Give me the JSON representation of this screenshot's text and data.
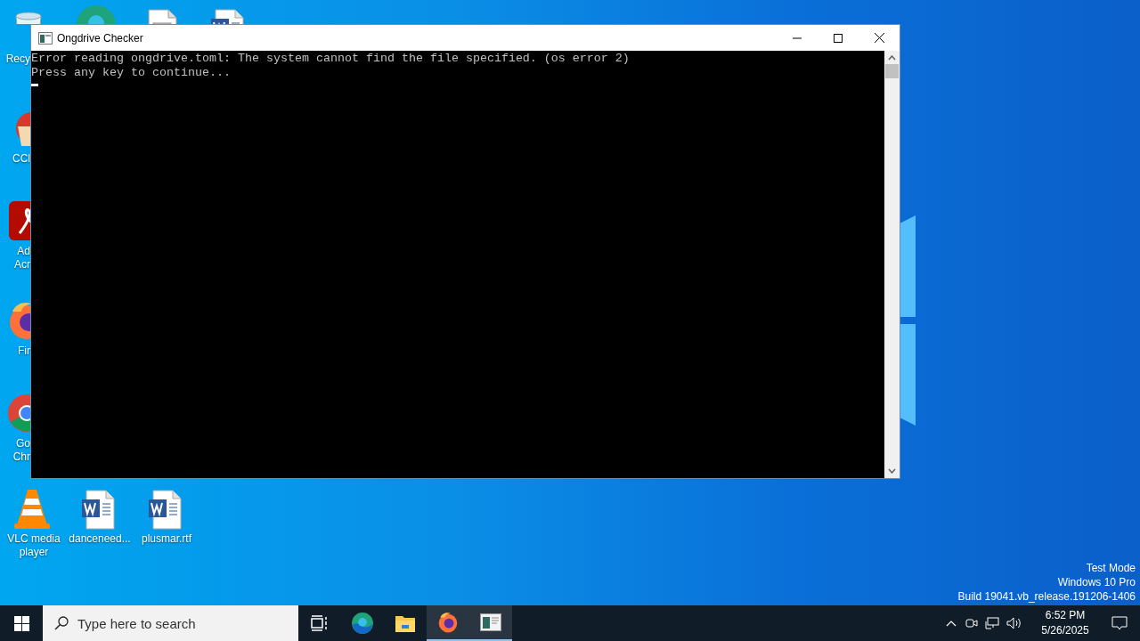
{
  "desktop": {
    "icons": [
      {
        "kind": "recycle-bin",
        "label": "Recy"
      },
      {
        "kind": "edge"
      },
      {
        "kind": "document"
      },
      {
        "kind": "word"
      },
      {
        "kind": "ccleaner",
        "label": "CCl"
      },
      {
        "kind": "acrobat",
        "label": "Ad\nAcr"
      },
      {
        "kind": "firefox",
        "label": "Fir"
      },
      {
        "kind": "chrome",
        "label": "Go\nChr"
      },
      {
        "kind": "vlc",
        "label": "VLC media\nplayer"
      },
      {
        "kind": "word",
        "label": "danceneed..."
      },
      {
        "kind": "word",
        "label": "plusmar.rtf"
      }
    ],
    "watermark_lines": [
      "Test Mode",
      "Windows 10 Pro",
      "Build 19041.vb_release.191206-1406"
    ]
  },
  "window": {
    "title": "Ongdrive Checker",
    "console_lines": [
      "Error reading ongdrive.toml: The system cannot find the file specified. (os error 2)",
      "Press any key to continue..."
    ]
  },
  "taskbar": {
    "search": {
      "placeholder": "Type here to search"
    },
    "apps": [
      {
        "kind": "task-view",
        "active": false
      },
      {
        "kind": "edge",
        "active": false
      },
      {
        "kind": "explorer",
        "active": false
      },
      {
        "kind": "firefox",
        "active": true
      },
      {
        "kind": "console",
        "active": true
      }
    ],
    "clock": {
      "time": "6:52 PM",
      "date": "5/26/2025"
    }
  }
}
